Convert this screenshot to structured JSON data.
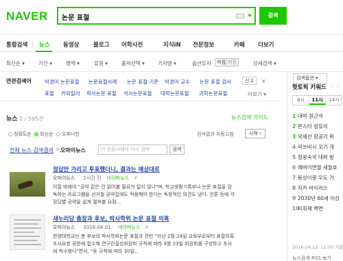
{
  "header": {
    "logo": "NAVER",
    "search_value": "논문 표절",
    "search_button": "검색"
  },
  "tabs": [
    {
      "label": "통합검색",
      "active": false
    },
    {
      "label": "뉴스",
      "active": true
    },
    {
      "label": "동영상",
      "active": false
    },
    {
      "label": "블로그",
      "active": false
    },
    {
      "label": "어학사전",
      "active": false
    },
    {
      "label": "지식iN",
      "active": false
    },
    {
      "label": "전문정보",
      "active": false
    },
    {
      "label": "카페",
      "active": false
    },
    {
      "label": "더보기",
      "active": false
    }
  ],
  "search_options_label": "검색옵션",
  "options": {
    "items": [
      "최신순",
      "기간",
      "영역",
      "유형",
      "출처선택",
      "기자명",
      "옵션유지",
      "상세검색"
    ],
    "keep_on": "꺼짐",
    "keep_off": "켜짐"
  },
  "related": {
    "title": "연관검색어",
    "row1": [
      "박경미 논문표절",
      "논문표절사례",
      "논문 표절 기준",
      "박경미 교수",
      "논문 표절 검사"
    ],
    "row2": [
      "표절",
      "카피킬러",
      "학사논문 표절",
      "석사논문표절",
      "대학논문표절",
      "과학논문표절"
    ],
    "report": "신고",
    "more": "더보기"
  },
  "news": {
    "title": "뉴스",
    "count": "1 / 595건",
    "guide": "뉴스검색 가이드",
    "radio_accuracy": "정확도순",
    "radio_latest": "최신순",
    "radio_opinion": "오피니언",
    "font_size": "검색결과 자동고침",
    "start_button": "시작",
    "breadcrumb_all": "전체 뉴스 검색결과",
    "breadcrumb_arrow": ">",
    "breadcrumb_source": "오마이뉴스",
    "inner_search_placeholder": "이 언론사에서 다시 검색",
    "inner_search_button": "검색"
  },
  "articles": [
    {
      "title": "정답만 가리고 투표했더니, 결과는 예상대로",
      "source": "오마이뉴스",
      "time": "2시간 전",
      "naver_news": "네이버뉴스",
      "desc": [
        "이럴 바에야 \"공약 같은 건 읽어볼 필요가 없지 않나\"며, 학교생활기록부나 논문 표절을 감",
        "독하는 프로그램을 선거철 공약집에도 적용해야 한다는 독창적인 의견도 냈다. 언론 등에 각",
        "정당별 공약을 쉽게 펼쳐볼 요점..."
      ]
    },
    {
      "title": "새누리당 총장과 후보, 박사학위 논문 표절 의혹",
      "source": "오마이뉴스",
      "time": "2016.04.01.",
      "naver_news": "네이버뉴스",
      "desc": [
        "한양대학교는 총 후보의 박사학위논문 표절과 관련 \"지난 2월 24일 교육부로부터 표절의혹",
        "조사요청 공문에 접수해 연구진실성위원회 규칙에 따라 3월 23일 위원회를 구성하고 조사",
        "에 착수했다\"면서, \"동 규칙에 따라 30일..."
      ]
    }
  ],
  "sidebar": {
    "title": "핫토픽 키워드",
    "tabs": [
      "8시",
      "11시",
      "14시"
    ],
    "active_tab": 1,
    "ranks": [
      {
        "rank": "1",
        "text": "대박 장근석"
      },
      {
        "rank": "2",
        "text": "몬스터 성유리"
      },
      {
        "rank": "3",
        "text": "국제선 항공기 위"
      },
      {
        "rank": "4",
        "text": "미쓰비시 꼬기 개"
      },
      {
        "rank": "5",
        "text": "정왕숙국 대파 방"
      },
      {
        "rank": "6",
        "text": "에버이연월 세월호"
      },
      {
        "rank": "7",
        "text": "동상이몽 우도 가"
      },
      {
        "rank": "8",
        "text": "지카 바이러스"
      },
      {
        "rank": "9",
        "text": "2030년 60세 이상"
      },
      {
        "rank": "10",
        "text": "이휘재 백연"
      }
    ],
    "footer": "2016.04.12. 11:00 기준",
    "rss": "뉴스검색 RSS 보기"
  }
}
